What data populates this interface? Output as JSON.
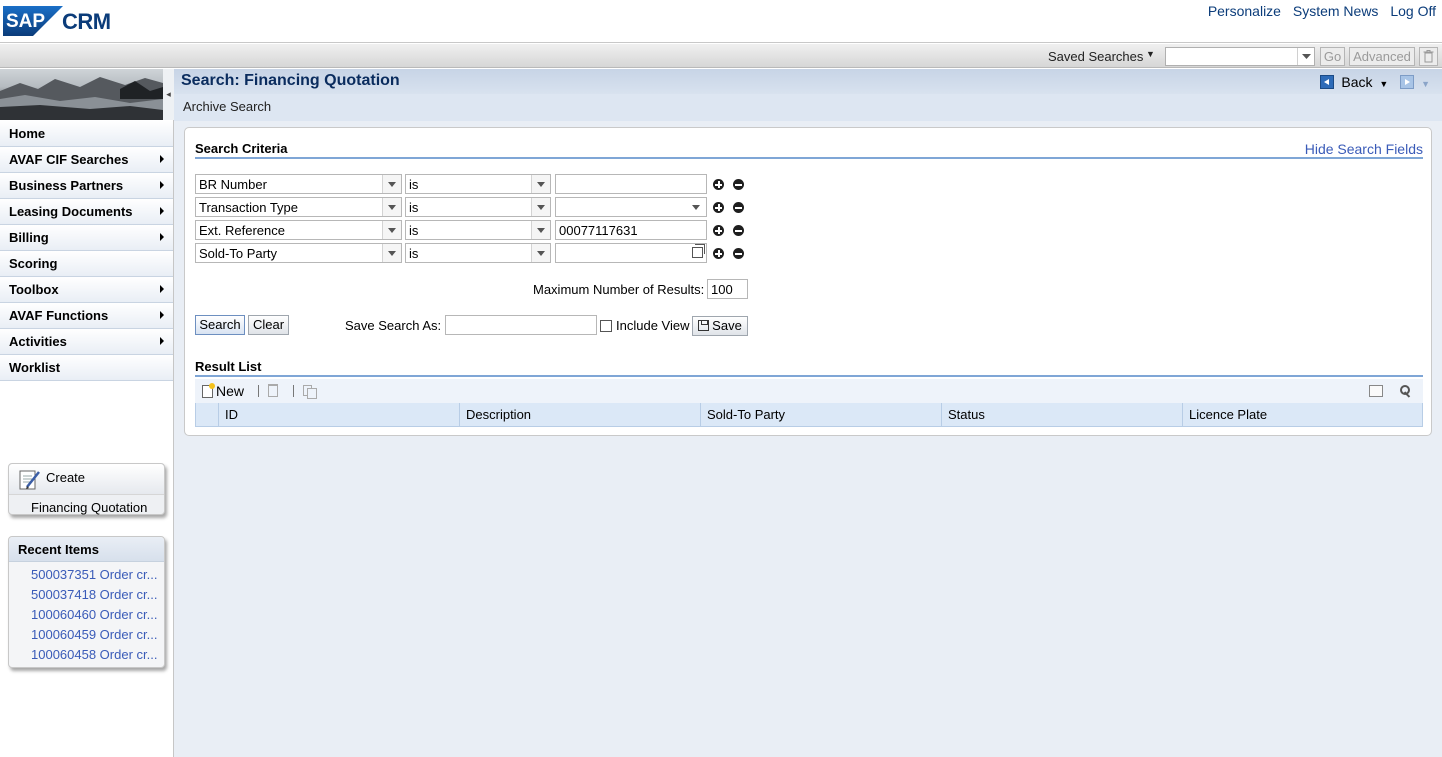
{
  "header": {
    "logo_sap": "SAP",
    "logo_crm": "CRM",
    "links": [
      "Personalize",
      "System News",
      "Log Off"
    ]
  },
  "toolbar": {
    "saved_searches_label": "Saved Searches",
    "saved_searches_value": "",
    "go_label": "Go",
    "advanced_label": "Advanced"
  },
  "nav": {
    "items": [
      {
        "label": "Home",
        "has_submenu": false
      },
      {
        "label": "AVAF CIF Searches",
        "has_submenu": true
      },
      {
        "label": "Business Partners",
        "has_submenu": true
      },
      {
        "label": "Leasing Documents",
        "has_submenu": true
      },
      {
        "label": "Billing",
        "has_submenu": true
      },
      {
        "label": "Scoring",
        "has_submenu": false
      },
      {
        "label": "Toolbox",
        "has_submenu": true
      },
      {
        "label": "AVAF Functions",
        "has_submenu": true
      },
      {
        "label": "Activities",
        "has_submenu": true
      },
      {
        "label": "Worklist",
        "has_submenu": false
      }
    ],
    "create_label": "Create",
    "create_link": "Financing Quotation",
    "recent_title": "Recent Items",
    "recent_items": [
      "500037351 Order cr...",
      "500037418 Order cr...",
      "100060460 Order cr...",
      "100060459 Order cr...",
      "100060458 Order cr..."
    ]
  },
  "main": {
    "title": "Search: Financing Quotation",
    "back_label": "Back",
    "subtitle": "Archive Search",
    "search_criteria_title": "Search Criteria",
    "hide_search_fields": "Hide Search Fields",
    "criteria": [
      {
        "field": "BR Number",
        "operator": "is",
        "value": "",
        "value_type": "text"
      },
      {
        "field": "Transaction Type",
        "operator": "is",
        "value": "",
        "value_type": "dropdown"
      },
      {
        "field": "Ext. Reference",
        "operator": "is",
        "value": "00077117631",
        "value_type": "text"
      },
      {
        "field": "Sold-To Party",
        "operator": "is",
        "value": "",
        "value_type": "f4"
      }
    ],
    "max_results_label": "Maximum Number of Results:",
    "max_results_value": "100",
    "search_button": "Search",
    "clear_button": "Clear",
    "save_search_label": "Save Search As:",
    "save_search_value": "",
    "include_view_label": "Include View",
    "include_view_checked": false,
    "save_button": "Save",
    "result_list_title": "Result List",
    "new_button": "New",
    "columns": [
      "ID",
      "Description",
      "Sold-To Party",
      "Status",
      "Licence Plate"
    ]
  },
  "colors": {
    "brand_blue": "#0b3c7a",
    "link_blue": "#3a5bb8",
    "main_bg": "#e9eef5",
    "accent_line": "#7fa6d6"
  }
}
